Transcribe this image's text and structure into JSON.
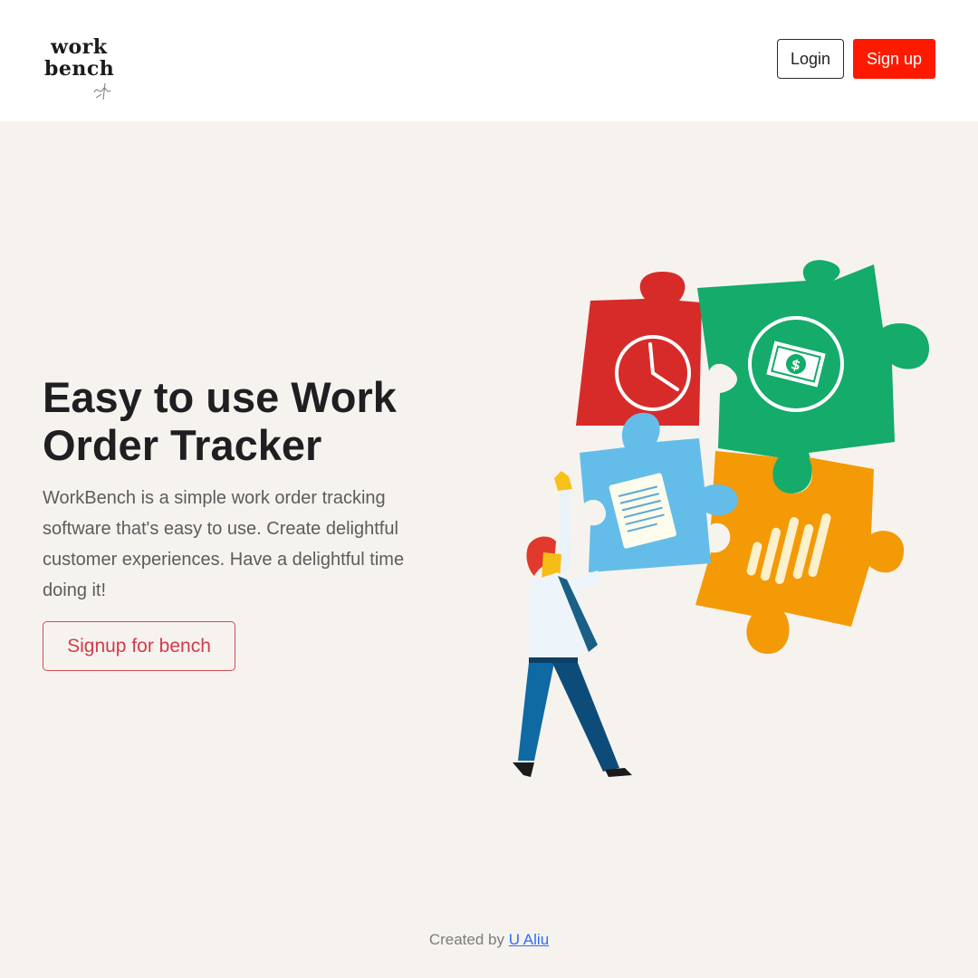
{
  "header": {
    "logo": {
      "line1": "work",
      "line2": "bench"
    },
    "login_label": "Login",
    "signup_label": "Sign up"
  },
  "hero": {
    "title": "Easy to use Work Order Tracker",
    "description": "WorkBench is a simple work order tracking software that's easy to use. Create delightful customer experiences. Have a delightful time doing it!",
    "cta_label": "Signup for bench"
  },
  "illustration": {
    "icons": [
      "clock-icon",
      "dollar-bill-icon",
      "document-icon",
      "sound-bars-icon"
    ]
  },
  "footer": {
    "prefix": "Created by",
    "author": "U Aliu"
  },
  "colors": {
    "background": "#f6f3ef",
    "signup_button": "#fe1a00",
    "cta_text": "#d33b4a",
    "link": "#2d6df6",
    "puzzle_red": "#d72b2a",
    "puzzle_green": "#14ab6b",
    "puzzle_blue": "#64bde8",
    "puzzle_orange": "#f39a06"
  }
}
